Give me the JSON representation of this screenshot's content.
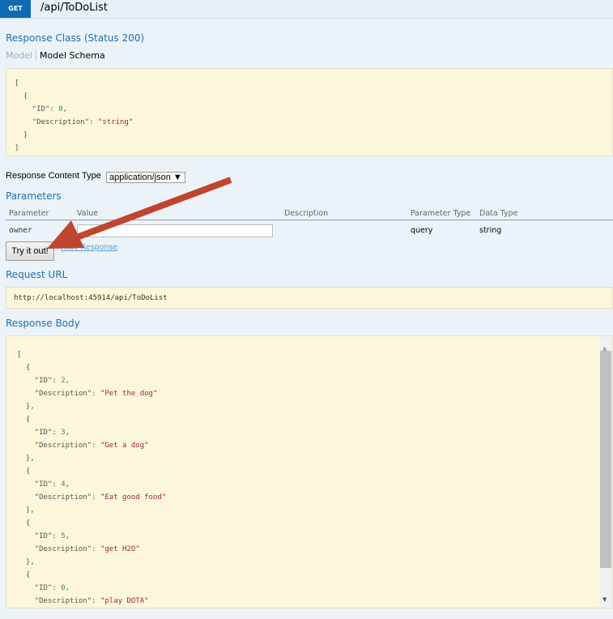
{
  "header": {
    "method": "GET",
    "path": "/api/ToDoList"
  },
  "response_class": {
    "title": "Response Class (Status 200)",
    "tabs": [
      "Model",
      "Model Schema"
    ],
    "schema_lines": [
      [
        "[",
        "",
        ""
      ],
      [
        "  {",
        "",
        ""
      ],
      [
        "    \"ID\": ",
        "0",
        ","
      ],
      [
        "    \"Description\": ",
        "\"string\"",
        ""
      ],
      [
        "  }",
        "",
        ""
      ],
      [
        "]",
        "",
        ""
      ]
    ]
  },
  "content_type": {
    "label": "Response Content Type",
    "selected": "application/json ▼"
  },
  "parameters": {
    "title": "Parameters",
    "headers": [
      "Parameter",
      "Value",
      "Description",
      "Parameter Type",
      "Data Type"
    ],
    "rows": [
      {
        "name": "owner",
        "value": "",
        "description": "",
        "param_type": "query",
        "data_type": "string"
      }
    ]
  },
  "try_button": "Try it out!",
  "hide_link": "Hide Response",
  "request_url": {
    "title": "Request URL",
    "value": "http://localhost:45914/api/ToDoList"
  },
  "response_body": {
    "title": "Response Body",
    "items": [
      {
        "id": "2",
        "description": "\"Pet the dog\""
      },
      {
        "id": "3",
        "description": "\"Get a dog\""
      },
      {
        "id": "4",
        "description": "\"Eat good food\""
      },
      {
        "id": "5",
        "description": "\"get H2O\""
      },
      {
        "id": "0",
        "description": "\"play DOTA\""
      }
    ]
  },
  "colors": {
    "get": "#0f6ab4",
    "arrow": "#c0452e",
    "heading": "#1f6fb0"
  }
}
